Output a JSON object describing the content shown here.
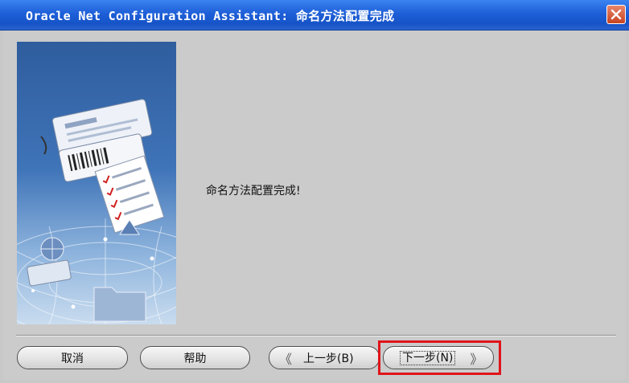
{
  "window": {
    "title": "Oracle Net Configuration Assistant: 命名方法配置完成",
    "close_icon": "close-icon"
  },
  "content": {
    "message": "命名方法配置完成!"
  },
  "buttons": {
    "cancel": "取消",
    "help": "帮助",
    "back": "上一步(B)",
    "next": "下一步(N)"
  },
  "colors": {
    "titlebar": "#1e5fd8",
    "highlight": "#e0141b",
    "background": "#cbcbcb"
  }
}
